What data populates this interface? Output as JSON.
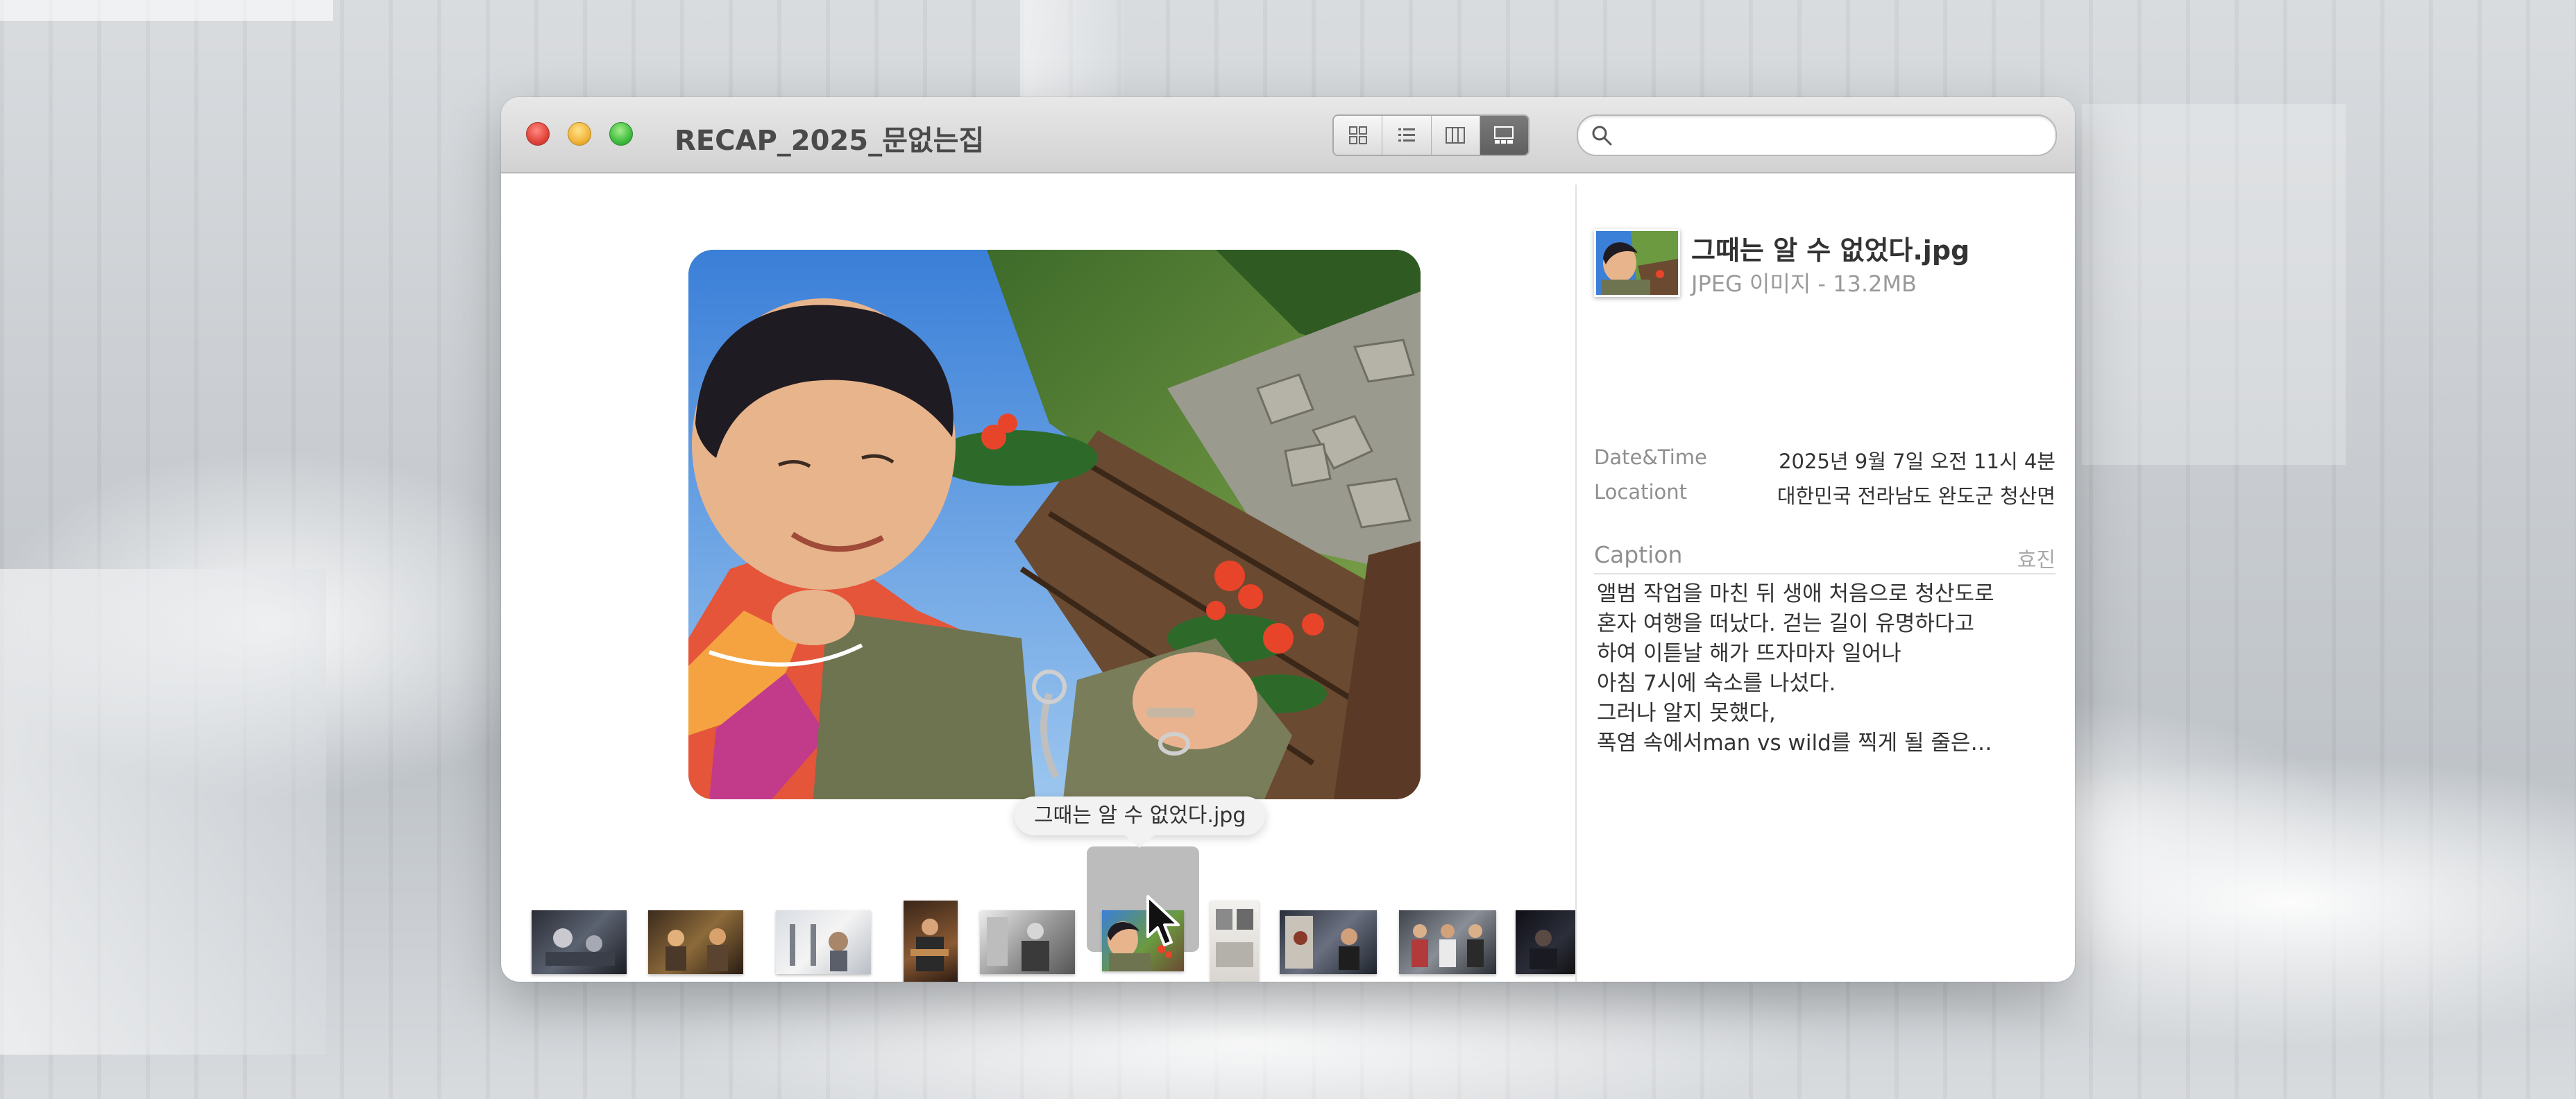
{
  "window": {
    "title": "RECAP_2025_문없는집"
  },
  "toolbar": {
    "view_modes": [
      "icon-view",
      "list-view",
      "column-view",
      "gallery-view"
    ],
    "active_view": "gallery-view",
    "search_placeholder": "",
    "search_value": ""
  },
  "preview": {
    "tooltip": "그때는 알 수 없었다.jpg"
  },
  "thumbnails": {
    "count": 11,
    "selected_index": 5
  },
  "info": {
    "file_name": "그때는 알 수 없었다.jpg",
    "file_type": "JPEG 이미지 - 13.2MB",
    "date_label": "Date&Time",
    "date_value": "2025년 9월 7일 오전 11시 4분",
    "location_label": "Locationt",
    "location_value": "대한민국 전라남도 완도군 청산면",
    "caption_label": "Caption",
    "caption_author": "효진",
    "caption_lines": [
      "앨범 작업을 마친 뒤 생애 처음으로 청산도로",
      "혼자 여행을 떠났다. 걷는 길이 유명하다고",
      "하여 이튿날 해가 뜨자마자 일어나",
      "아침 7시에 숙소를 나섰다.",
      "그러나 알지 못했다,",
      "폭염 속에서man vs wild를 찍게 될 줄은…"
    ]
  },
  "colors": {
    "close": "#e0443b",
    "minimize": "#f2b43a",
    "maximize": "#3fbd3f",
    "text": "#333333",
    "muted": "#8f8f8f"
  }
}
